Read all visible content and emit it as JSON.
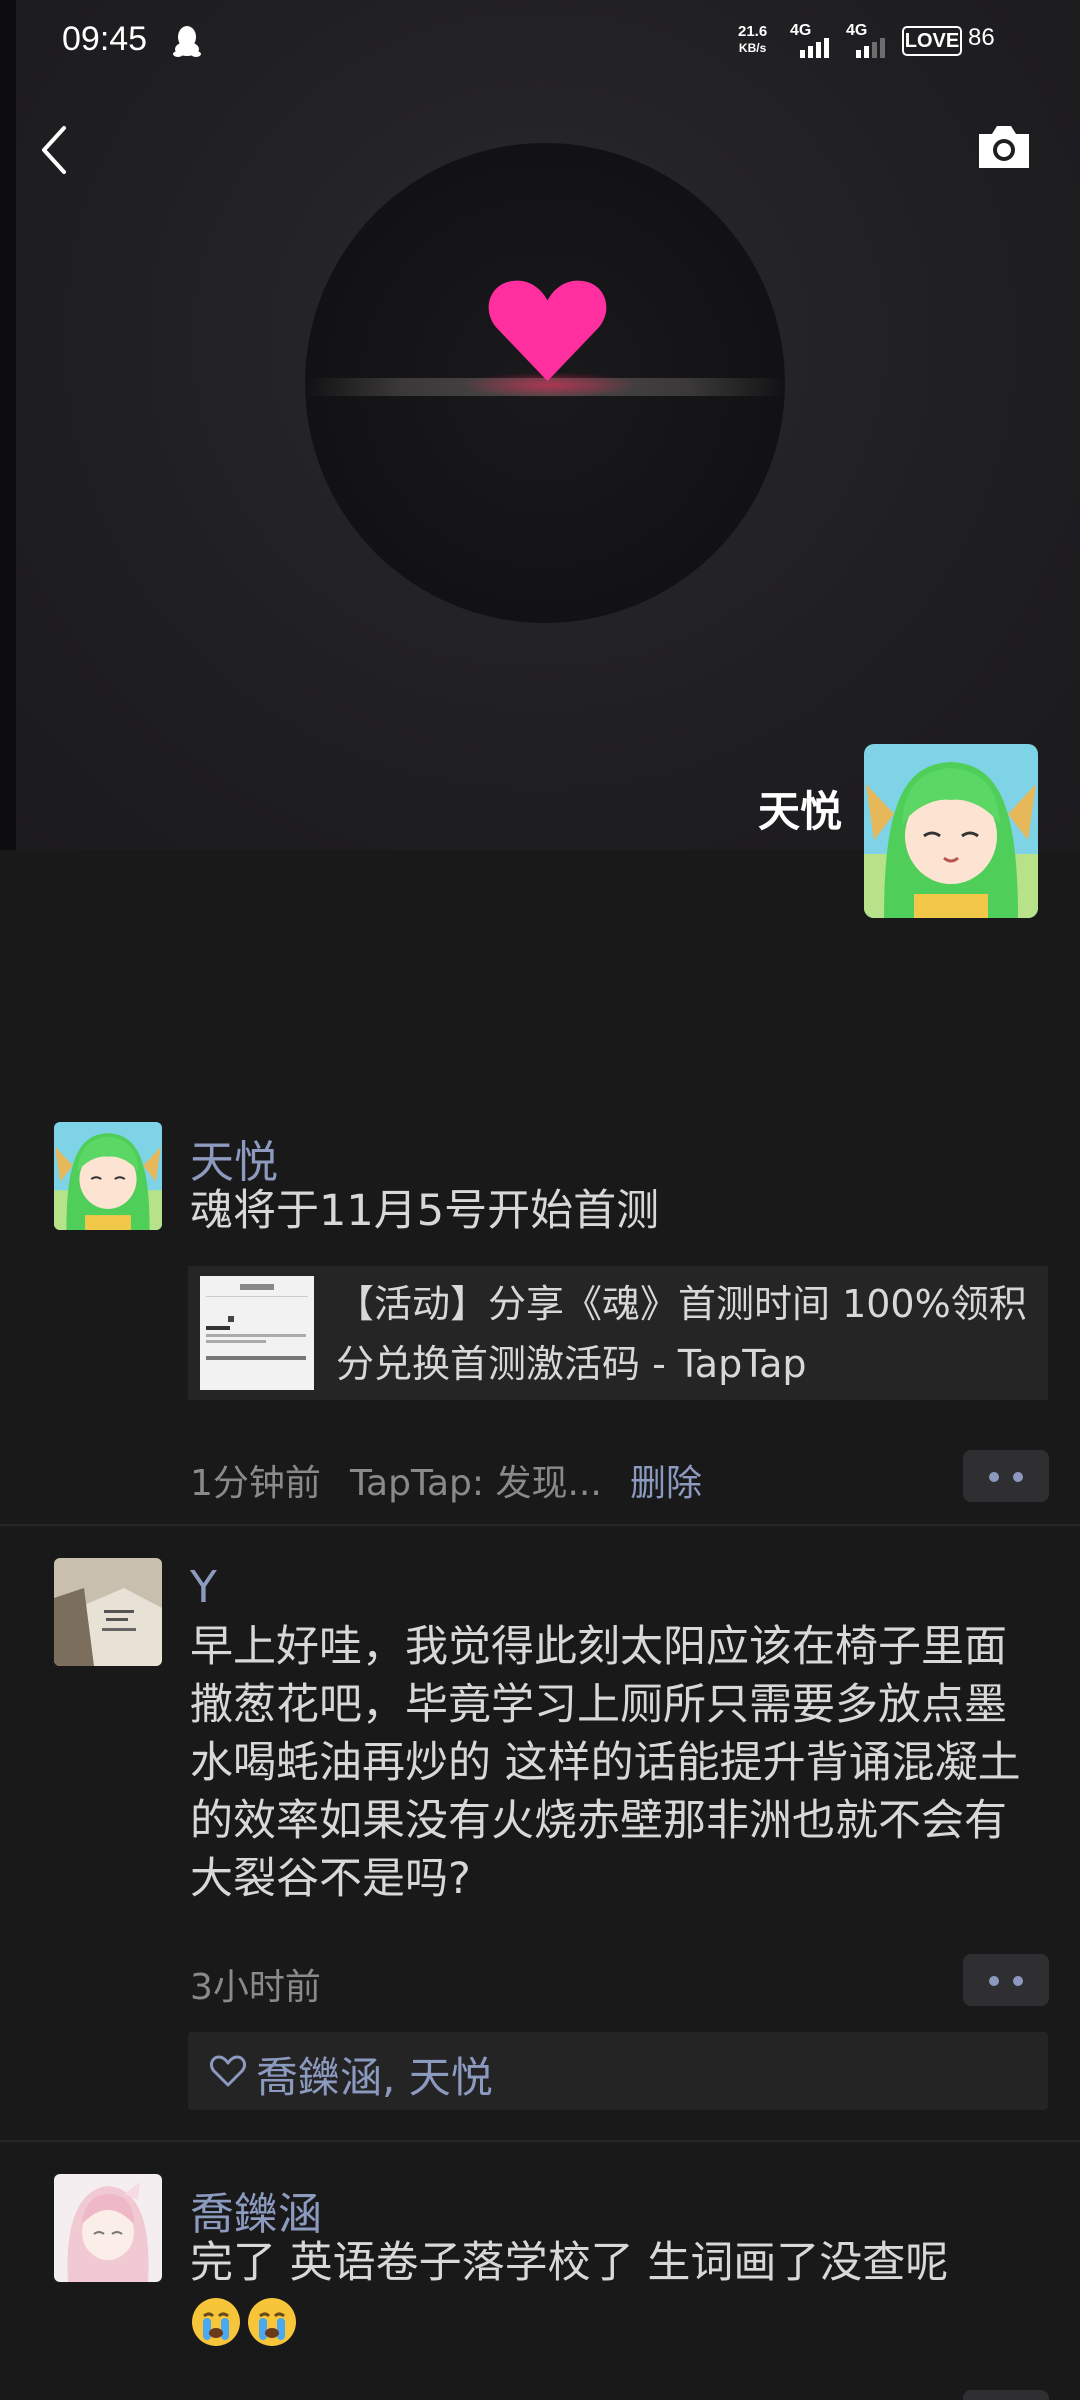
{
  "status_bar": {
    "time": "09:45",
    "net_speed_value": "21.6",
    "net_speed_unit": "KB/s",
    "signal1_label": "4G",
    "signal2_label": "4G",
    "battery_text": "LOVE",
    "battery_level": "86"
  },
  "cover": {
    "user_name": "天悦"
  },
  "posts": [
    {
      "name": "天悦",
      "text": "魂将于11月5号开始首测",
      "link_title": "【活动】分享《魂》首测时间 100%领积分兑换首测激活码 - TapTap",
      "time": "1分钟前",
      "source": "TapTap: 发现...",
      "delete_label": "删除"
    },
    {
      "name": "Y",
      "text": "早上好哇，我觉得此刻太阳应该在椅子里面撒葱花吧，毕竟学习上厕所只需要多放点墨水喝蚝油再炒的 这样的话能提升背诵混凝土的效率如果没有火烧赤壁那非洲也就不会有大裂谷不是吗?",
      "time": "3小时前",
      "likes": "喬鑠涵, 天悦"
    },
    {
      "name": "喬鑠涵",
      "text": "完了 英语卷子落学校了 生词画了没查呢"
    }
  ],
  "colors": {
    "background": "#191919",
    "name_blue": "#8c9ac0",
    "heart_pink": "#ff2fa0"
  }
}
